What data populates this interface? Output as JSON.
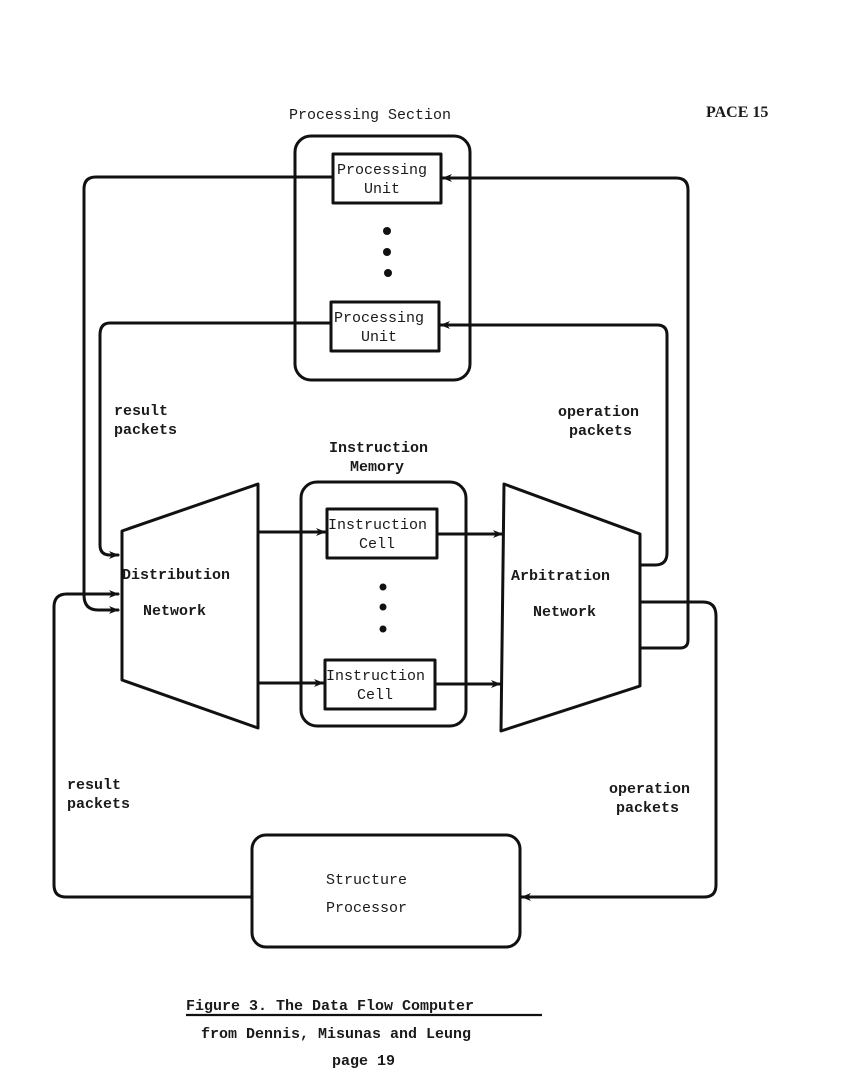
{
  "page_label": "PACE 15",
  "processing_section": {
    "title": "Processing Section",
    "units": [
      {
        "line1": "Processing",
        "line2": "Unit"
      },
      {
        "line1": "Processing",
        "line2": "Unit"
      }
    ],
    "ellipsis": "• • •"
  },
  "instruction_memory": {
    "title_line1": "Instruction",
    "title_line2": "Memory",
    "cells": [
      {
        "line1": "Instruction",
        "line2": "Cell"
      },
      {
        "line1": "Instruction",
        "line2": "Cell"
      }
    ]
  },
  "distribution_network": {
    "line1": "Distribution",
    "line2": "Network"
  },
  "arbitration_network": {
    "line1": "Arbitration",
    "line2": "Network"
  },
  "structure_processor": {
    "line1": "Structure",
    "line2": "Processor"
  },
  "labels": {
    "result_packets_upper": {
      "line1": "result",
      "line2": "packets"
    },
    "operation_packets_upper": {
      "line1": "operation",
      "line2": "packets"
    },
    "result_packets_lower": {
      "line1": "result",
      "line2": "packets"
    },
    "operation_packets_lower": {
      "line1": "operation",
      "line2": "packets"
    }
  },
  "caption": {
    "title": "Figure 3.  The Data Flow Computer",
    "source": "from Dennis, Misunas and Leung",
    "page": "page 19"
  }
}
